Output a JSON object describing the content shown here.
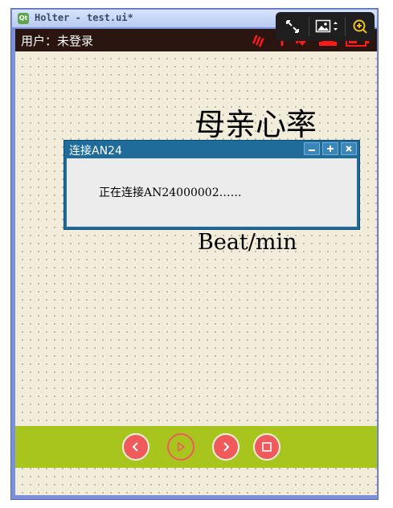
{
  "window": {
    "title": "Holter - test.ui*",
    "app_icon_text": "Qt"
  },
  "header": {
    "user_label": "用户：未登录"
  },
  "main": {
    "heading": "母亲心率",
    "unit": "Beat/min"
  },
  "dialog": {
    "title": "连接AN24",
    "message": "正在连接AN24000002……"
  },
  "controls": [
    "previous-icon",
    "play-icon",
    "next-icon",
    "stop-icon"
  ],
  "colors": {
    "bottom_bar": "#a8c51e",
    "control_buttons": "#f05a5a",
    "status_icons": "#ff1a1a",
    "dialog_frame": "#1f6c9b",
    "canvas": "#f2ecda"
  },
  "status_icons": [
    "heat-icon",
    "arrow-up-icon",
    "arrow-down-icon",
    "marker-icon",
    "battery-icon"
  ]
}
